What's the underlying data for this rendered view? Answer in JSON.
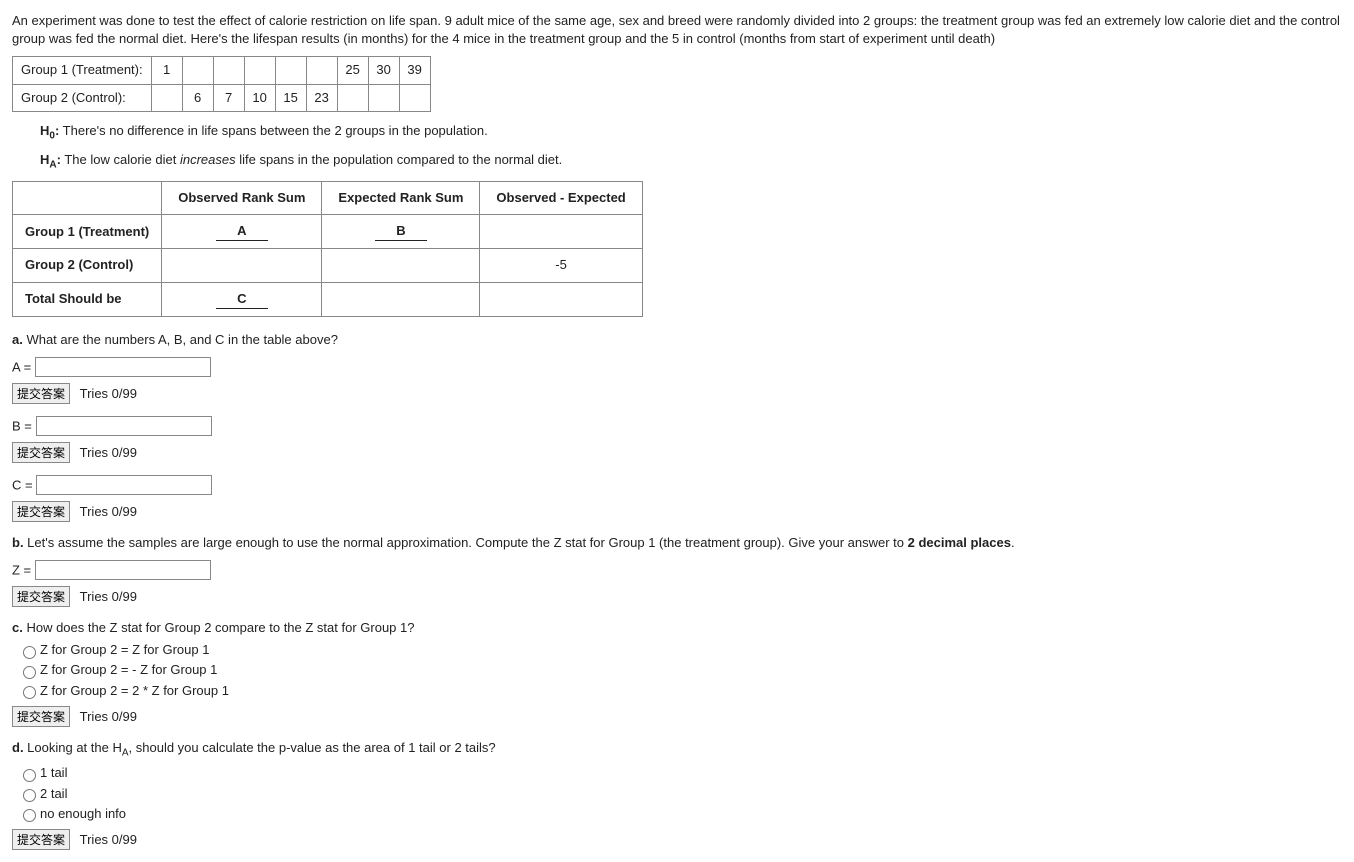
{
  "intro": "An experiment was done to test the effect of calorie restriction on life span. 9 adult mice of the same age, sex and breed were randomly divided into 2 groups: the treatment group was fed an extremely low calorie diet and the control group was fed the normal diet. Here's the lifespan results (in months) for the 4 mice in the treatment group and the 5 in control (months from start of experiment until death)",
  "table1": {
    "row1_label": "Group 1 (Treatment):",
    "row1": [
      "1",
      "",
      "",
      "",
      "",
      "",
      "25",
      "30",
      "39"
    ],
    "row2_label": "Group 2 (Control):",
    "row2": [
      "",
      "6",
      "7",
      "10",
      "15",
      "23",
      "",
      "",
      ""
    ]
  },
  "h0_label": "H",
  "h0_sub": "0",
  "h0_text": " There's no difference in life spans between the 2 groups in the population.",
  "ha_label": "H",
  "ha_sub": "A",
  "ha_text_pre": " The low calorie diet ",
  "ha_text_em": "increases",
  "ha_text_post": " life spans in the population compared to the normal diet.",
  "rank_table": {
    "headers": [
      "",
      "Observed Rank Sum",
      "Expected Rank Sum",
      "Observed - Expected"
    ],
    "rows": [
      {
        "label": "Group 1 (Treatment)",
        "obs": "A",
        "exp": "B",
        "diff": ""
      },
      {
        "label": "Group 2 (Control)",
        "obs": "",
        "exp": "",
        "diff": "-5"
      },
      {
        "label": "Total Should be",
        "obs": "C",
        "exp": "",
        "diff": ""
      }
    ]
  },
  "qa": {
    "label": "a.",
    "text": " What are the numbers A, B, and C in the table above?",
    "A_label": "A =",
    "B_label": "B =",
    "C_label": "C ="
  },
  "qb": {
    "label": "b.",
    "text": " Let's assume the samples are large enough to use the normal approximation. Compute the Z stat for Group 1 (the treatment group). Give your answer to ",
    "bold": "2 decimal places",
    "post": ".",
    "Z_label": "Z ="
  },
  "qc": {
    "label": "c.",
    "text": " How does the Z stat for Group 2 compare to the Z stat for Group 1?",
    "opts": [
      "Z for Group 2 = Z for Group 1",
      "Z for Group 2 = - Z for Group 1",
      "Z for Group 2 = 2 * Z for Group 1"
    ]
  },
  "qd": {
    "label": "d.",
    "text_pre": " Looking at the H",
    "text_sub": "A",
    "text_post": ", should you calculate the p-value as the area of 1 tail or 2 tails?",
    "opts": [
      "1 tail",
      "2 tail",
      "no enough info"
    ]
  },
  "submit_label": "提交答案",
  "tries_label": "Tries 0/99"
}
